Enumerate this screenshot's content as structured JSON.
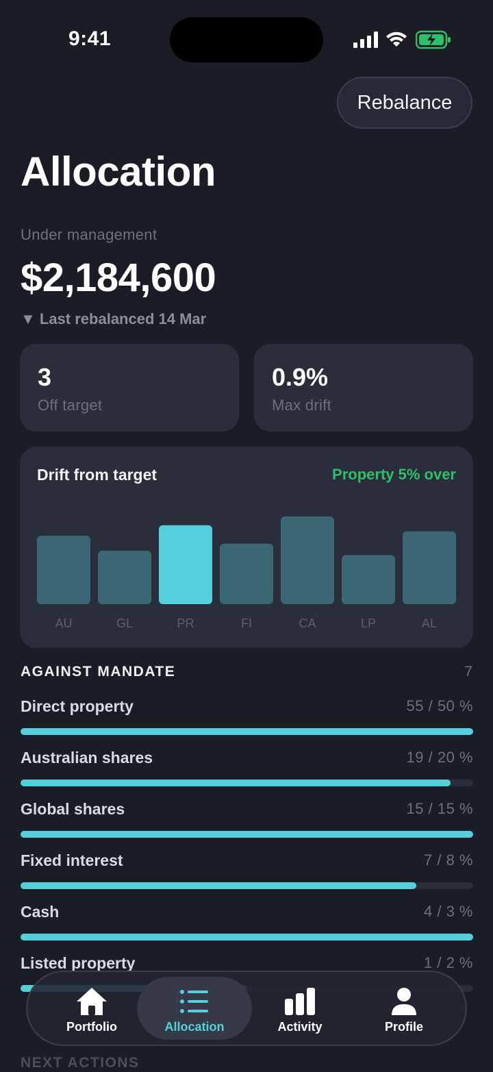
{
  "status": {
    "time": "9:41"
  },
  "header": {
    "rebalance_label": "Rebalance",
    "title": "Allocation"
  },
  "aum": {
    "label": "Under management",
    "value": "$2,184,600",
    "last_rebalanced": "▼ Last rebalanced 14 Mar"
  },
  "stats": [
    {
      "value": "3",
      "label": "Off target"
    },
    {
      "value": "0.9%",
      "label": "Max drift"
    }
  ],
  "chart_data": {
    "type": "bar",
    "title": "Drift from target",
    "annotation": "Property 5% over",
    "categories": [
      "AU",
      "GL",
      "PR",
      "FI",
      "CA",
      "LP",
      "AL"
    ],
    "values": [
      0.78,
      0.61,
      0.9,
      0.69,
      1.0,
      0.56,
      0.83
    ],
    "highlight_index": 2,
    "colors": {
      "bar": "#3a6773",
      "highlight": "#56cfdd",
      "note": "#2fbf6a"
    }
  },
  "mandate": {
    "title": "AGAINST MANDATE",
    "count": "7",
    "rows": [
      {
        "name": "Direct property",
        "value": "55 / 50 %",
        "progress": 1.0
      },
      {
        "name": "Australian shares",
        "value": "19 / 20 %",
        "progress": 0.95
      },
      {
        "name": "Global shares",
        "value": "15 / 15 %",
        "progress": 1.0
      },
      {
        "name": "Fixed interest",
        "value": "7 / 8 %",
        "progress": 0.875
      },
      {
        "name": "Cash",
        "value": "4 / 3 %",
        "progress": 1.0
      },
      {
        "name": "Listed property",
        "value": "1 / 2 %",
        "progress": 0.5
      }
    ]
  },
  "next_actions_title": "NEXT ACTIONS",
  "tabs": [
    {
      "label": "Portfolio",
      "icon": "home-icon"
    },
    {
      "label": "Allocation",
      "icon": "list-icon",
      "active": true
    },
    {
      "label": "Activity",
      "icon": "bar-chart-icon"
    },
    {
      "label": "Profile",
      "icon": "person-icon"
    }
  ]
}
